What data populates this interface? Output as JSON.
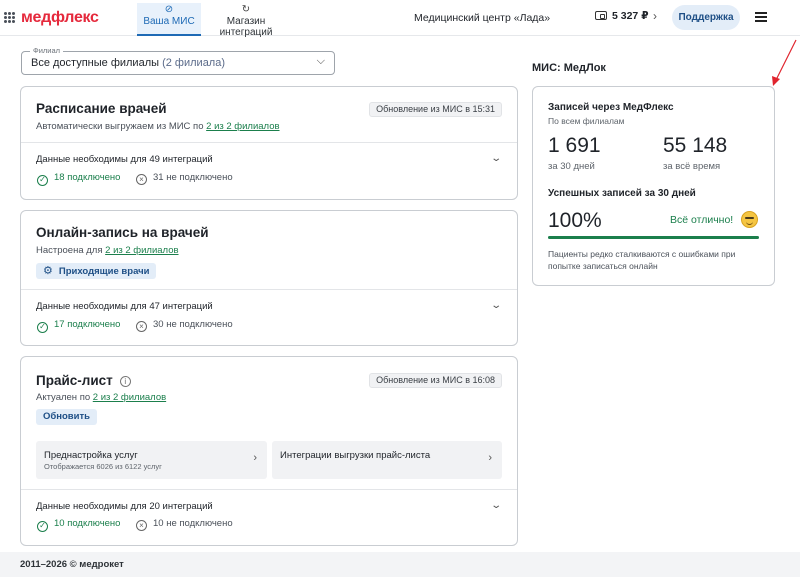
{
  "header": {
    "logo": "медфлекс",
    "tabs": [
      {
        "label": "Ваша МИС",
        "icon": "compass-icon"
      },
      {
        "label": "Магазин интеграций",
        "icon": "rotate-icon"
      }
    ],
    "center_name": "Медицинский центр «Лада»",
    "balance": "5 327 ₽",
    "support_label": "Поддержка"
  },
  "branch": {
    "label": "Филиал",
    "value": "Все доступные филиалы",
    "count": "(2 филиала)"
  },
  "cards": {
    "schedule": {
      "title": "Расписание врачей",
      "sub_prefix": "Автоматически выгружаем из МИС по ",
      "sub_link": "2 из 2 филиалов",
      "badge": "Обновление из МИС в 15:31",
      "need": "Данные необходимы для 49 интеграций",
      "connected": "18 подключено",
      "not_connected": "31 не подключено"
    },
    "online": {
      "title": "Онлайн-запись на врачей",
      "sub_prefix": "Настроена для ",
      "sub_link": "2 из 2 филиалов",
      "button": "Приходящие врачи",
      "need": "Данные необходимы для 47 интеграций",
      "connected": "17 подключено",
      "not_connected": "30 не подключено"
    },
    "price": {
      "title": "Прайс-лист",
      "sub_prefix": "Актуален по ",
      "sub_link": "2 из 2 филиалов",
      "badge": "Обновление из МИС в 16:08",
      "button": "Обновить",
      "box1_title": "Преднастройка услуг",
      "box1_sub": "Отображается 6026 из 6122 услуг",
      "box2_title": "Интеграции выгрузки прайс-листа",
      "need": "Данные необходимы для 20 интеграций",
      "connected": "10 подключено",
      "not_connected": "10 не подключено"
    }
  },
  "mis": {
    "title": "МИС: МедЛок",
    "header": "Записей через МедФлекс",
    "sub": "По всем филиалам",
    "v1": "1 691",
    "l1": "за 30 дней",
    "v2": "55 148",
    "l2": "за всё время",
    "success_header": "Успешных записей за 30 дней",
    "percent": "100%",
    "percent_value": 100,
    "ok": "Всё отлично!",
    "note": "Пациенты редко сталкиваются с ошибками при попытке записаться онлайн"
  },
  "footer": "2011–2026 © медрокет",
  "colors": {
    "brand": "#e5293c",
    "accent": "#1e6ab5",
    "success": "#1b7f4c",
    "annotation": "#e0242e"
  }
}
